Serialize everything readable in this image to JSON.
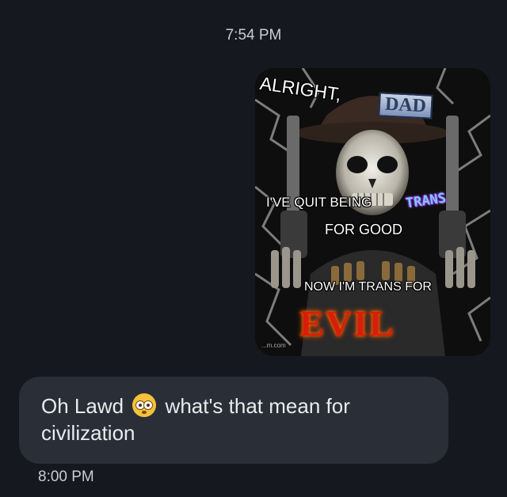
{
  "conversation": {
    "incoming_image": {
      "timestamp": "7:54 PM",
      "meme": {
        "alright": "ALRIGHT,",
        "dad": "DAD",
        "quit": "I'VE QUIT BEING",
        "trans": "TRANS",
        "for_good": "FOR GOOD",
        "now": "NOW I'M TRANS FOR",
        "evil": "EVIL",
        "watermark": "...m.com"
      }
    },
    "reply": {
      "text_before": "Oh Lawd",
      "emoji": "flushed-face-emoji",
      "text_after": "what's that mean for civilization",
      "timestamp": "8:00 PM"
    }
  },
  "colors": {
    "background": "#15191f",
    "reply_bubble": "#2a2f37",
    "text": "#e9ebee",
    "evil_red": "#d81e0a"
  }
}
